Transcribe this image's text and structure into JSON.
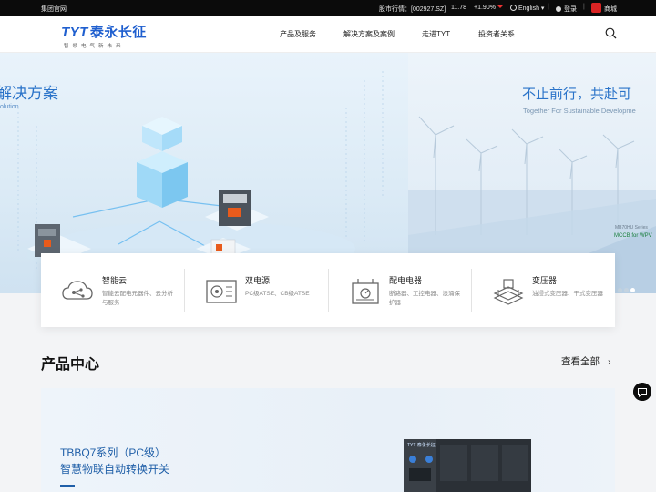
{
  "topbar": {
    "group_site": "集团官网",
    "stock_label": "股市行情：[002927.SZ]",
    "stock_price": "11.78",
    "stock_change": "+1.90%",
    "language": "English",
    "login": "登录",
    "mall": "商城"
  },
  "header": {
    "logo_en": "TYT",
    "logo_cn": "泰永长征",
    "logo_slogan": "智领电气新未来",
    "nav": [
      "产品及服务",
      "解决方案及案例",
      "走进TYT",
      "投资者关系"
    ]
  },
  "hero": {
    "left_title": "解决方案",
    "left_subtitle": "olution",
    "right_title": "不止前行，共赴可",
    "right_subtitle": "Together For Sustainable Developme",
    "series_tag": "MB70HU Series",
    "mccb_tag": "MCCB for WPV"
  },
  "categories": [
    {
      "title": "智能云",
      "desc": "智能云配电元器件、云分析与服务",
      "icon": "cloud-network-icon"
    },
    {
      "title": "双电源",
      "desc": "PC级ATSE、CB级ATSE",
      "icon": "transfer-switch-icon"
    },
    {
      "title": "配电电器",
      "desc": "断路器、工控电器、浪涌保护器",
      "icon": "distribution-device-icon"
    },
    {
      "title": "变压器",
      "desc": "油浸式变压器、干式变压器",
      "icon": "transformer-icon"
    }
  ],
  "product_center": {
    "title": "产品中心",
    "view_all": "查看全部",
    "banner_line1": "TBBQ7系列（PC级）",
    "banner_line2": "智慧物联自动转换开关",
    "device_brand": "TYT 泰永长征"
  },
  "colors": {
    "brand_blue": "#1f5fcf",
    "topbar_bg": "#0b0b0b",
    "stock_red": "#e33333"
  }
}
